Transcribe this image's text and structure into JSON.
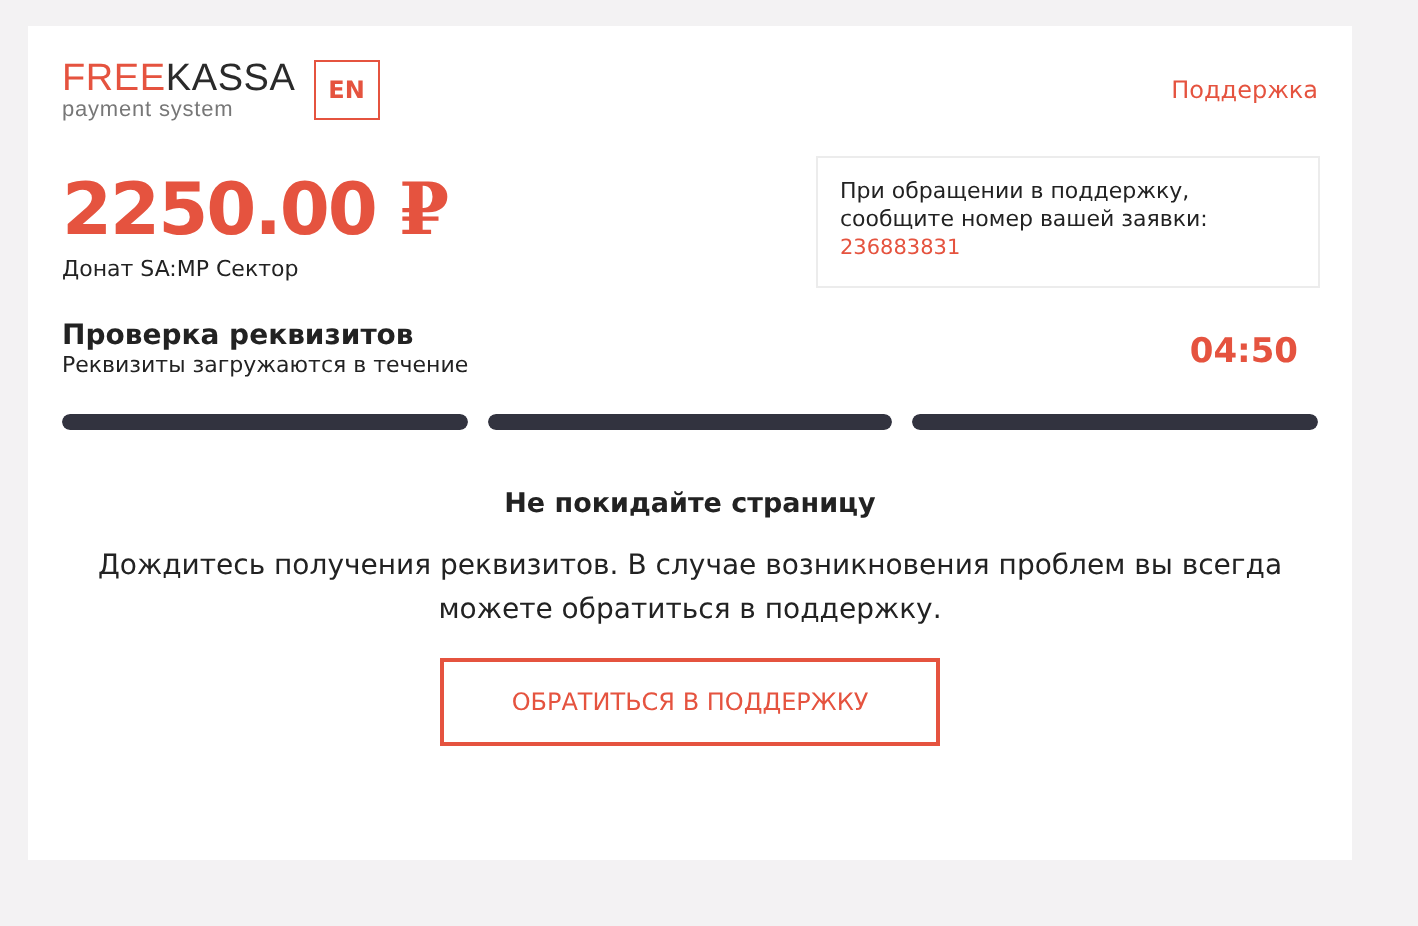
{
  "header": {
    "logo": {
      "accent": "FREE",
      "rest": "KASSA",
      "tagline": "payment system"
    },
    "language_button": "EN",
    "support_link": "Поддержка"
  },
  "payment": {
    "amount": "2250.00",
    "currency": "₽",
    "description": "Донат SA:MP Сектор"
  },
  "notice": {
    "text": "При обращении в поддержку, сообщите номер вашей заявки:",
    "order_number": "236883831"
  },
  "status": {
    "title": "Проверка реквизитов",
    "subtitle": "Реквизиты загружаются в течение",
    "timer": "04:50"
  },
  "progress": [
    {
      "level": 1
    },
    {
      "level": 1
    },
    {
      "level": 1
    }
  ],
  "message": {
    "title": "Не покидайте страницу",
    "text": "Дождитесь получения реквизитов. В случае возникновения проблем вы всегда можете обратиться в поддержку."
  },
  "support_button": "ОБРАТИТЬСЯ В ПОДДЕРЖКУ"
}
